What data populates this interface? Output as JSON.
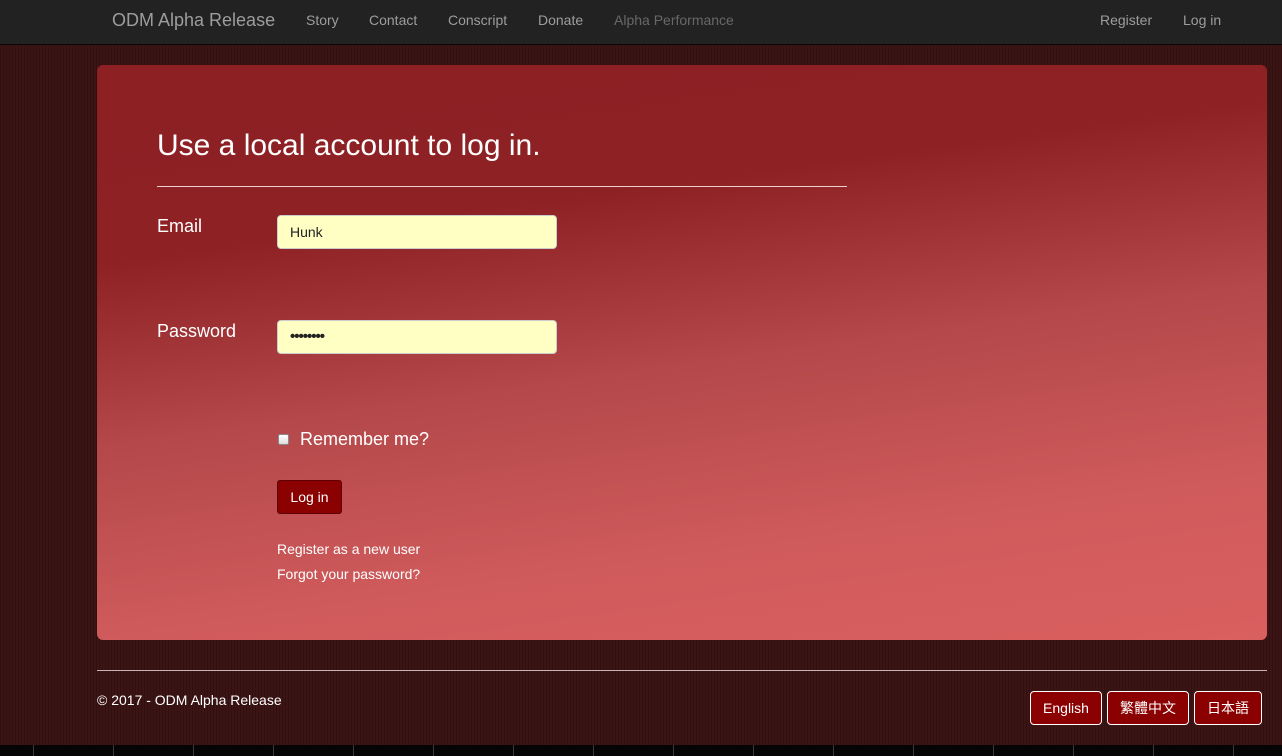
{
  "navbar": {
    "brand": "ODM Alpha Release",
    "links": [
      "Story",
      "Contact",
      "Conscript",
      "Donate",
      "Alpha Performance"
    ],
    "right_links": [
      "Register",
      "Log in"
    ]
  },
  "login": {
    "heading": "Use a local account to log in.",
    "email_label": "Email",
    "email_value": "Hunk",
    "password_label": "Password",
    "password_masked": "••••••••",
    "remember_label": "Remember me?",
    "remember_checked": false,
    "submit_label": "Log in",
    "register_link": "Register as a new user",
    "forgot_link": "Forgot your password?"
  },
  "footer": {
    "copyright": "© 2017 - ODM Alpha Release",
    "languages": [
      "English",
      "繁體中文",
      "日本語"
    ]
  },
  "colors": {
    "card_top": "#8c2023",
    "card_bottom": "#da5f5f",
    "input_fill": "#ffffc4",
    "button_fill": "#8b0000",
    "navbar": "#222222"
  }
}
